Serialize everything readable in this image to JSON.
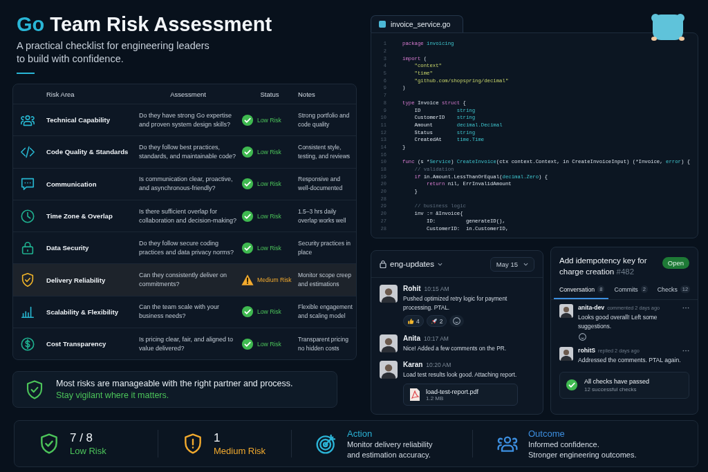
{
  "header": {
    "title_accent": "Go",
    "title": "Team Risk Assessment",
    "subtitle": "A practical checklist for engineering leaders to build with confidence."
  },
  "table": {
    "columns": [
      "Risk Area",
      "Assessment",
      "Status",
      "Notes"
    ],
    "rows": [
      {
        "area": "Technical Capability",
        "assessment": "Do they have strong Go expertise and proven system design skills?",
        "status": "Low Risk",
        "kind": "low",
        "notes": "Strong portfolio and code quality",
        "highlighted": false
      },
      {
        "area": "Code Quality & Standards",
        "assessment": "Do they follow best practices, standards, and maintainable code?",
        "status": "Low Risk",
        "kind": "low",
        "notes": "Consistent style, testing, and reviews",
        "highlighted": false
      },
      {
        "area": "Communication",
        "assessment": "Is communication clear, proactive, and asynchronous-friendly?",
        "status": "Low Risk",
        "kind": "low",
        "notes": "Responsive and well-documented",
        "highlighted": false
      },
      {
        "area": "Time Zone & Overlap",
        "assessment": "Is there sufficient overlap for collaboration and decision-making?",
        "status": "Low Risk",
        "kind": "low",
        "notes": "1.5–3 hrs daily overlap works well",
        "highlighted": false
      },
      {
        "area": "Data Security",
        "assessment": "Do they follow secure coding practices and data privacy norms?",
        "status": "Low Risk",
        "kind": "low",
        "notes": "Security practices in place",
        "highlighted": false
      },
      {
        "area": "Delivery Reliability",
        "assessment": "Can they consistently deliver on commitments?",
        "status": "Medium Risk",
        "kind": "medium",
        "notes": "Monitor scope creep and estimations",
        "highlighted": true
      },
      {
        "area": "Scalability & Flexibility",
        "assessment": "Can the team scale with your business needs?",
        "status": "Low Risk",
        "kind": "low",
        "notes": "Flexible engagement and scaling model",
        "highlighted": false
      },
      {
        "area": "Cost Transparency",
        "assessment": "Is pricing clear, fair, and aligned to value delivered?",
        "status": "Low Risk",
        "kind": "low",
        "notes": "Transparent pricing no hidden costs",
        "highlighted": false
      }
    ]
  },
  "summary": {
    "text": "Most risks are manageable with the right partner and process.",
    "note": "Stay vigilant where it matters."
  },
  "code_editor": {
    "tab": "invoice_service.go",
    "lines": [
      {
        "number": "1",
        "tokens": [
          {
            "text": "package",
            "kind": "keyword"
          },
          {
            "text": " invoicing",
            "kind": "type"
          }
        ]
      },
      {
        "number": "2"
      },
      {
        "number": "3",
        "tokens": [
          {
            "text": "import",
            "kind": "keyword"
          },
          {
            "text": " (",
            "kind": "plain"
          }
        ]
      },
      {
        "number": "4",
        "tokens": [
          {
            "text": "    \"context\"",
            "kind": "string"
          }
        ]
      },
      {
        "number": "5",
        "tokens": [
          {
            "text": "    \"time\"",
            "kind": "string"
          }
        ]
      },
      {
        "number": "6",
        "tokens": [
          {
            "text": "    \"github.com/shopspring/decimal\"",
            "kind": "string"
          }
        ]
      },
      {
        "number": "9",
        "tokens": [
          {
            "text": ")",
            "kind": "plain"
          }
        ]
      },
      {
        "number": "7"
      },
      {
        "number": "8",
        "tokens": [
          {
            "text": "type",
            "kind": "keyword"
          },
          {
            "text": " Invoice ",
            "kind": "plain"
          },
          {
            "text": "struct",
            "kind": "keyword"
          },
          {
            "text": " {",
            "kind": "plain"
          }
        ]
      },
      {
        "number": "9",
        "tokens": [
          {
            "text": "    ID            ",
            "kind": "plain"
          },
          {
            "text": "string",
            "kind": "type"
          }
        ]
      },
      {
        "number": "10",
        "tokens": [
          {
            "text": "    CustomerID    ",
            "kind": "plain"
          },
          {
            "text": "string",
            "kind": "type"
          }
        ]
      },
      {
        "number": "11",
        "tokens": [
          {
            "text": "    Amount        ",
            "kind": "plain"
          },
          {
            "text": "decimal.Decimal",
            "kind": "type"
          }
        ]
      },
      {
        "number": "12",
        "tokens": [
          {
            "text": "    Status        ",
            "kind": "plain"
          },
          {
            "text": "string",
            "kind": "type"
          }
        ]
      },
      {
        "number": "13",
        "tokens": [
          {
            "text": "    CreatedAt     ",
            "kind": "plain"
          },
          {
            "text": "time.Time",
            "kind": "type"
          }
        ]
      },
      {
        "number": "14",
        "tokens": [
          {
            "text": "}",
            "kind": "plain"
          }
        ]
      },
      {
        "number": "16"
      },
      {
        "number": "10",
        "tokens": [
          {
            "text": "func",
            "kind": "keyword"
          },
          {
            "text": " (s *",
            "kind": "plain"
          },
          {
            "text": "Service",
            "kind": "type"
          },
          {
            "text": ") ",
            "kind": "plain"
          },
          {
            "text": "CreateInvoice",
            "kind": "type"
          },
          {
            "text": "(ctx context.Context, in CreateInvoiceInput) (*Invoice, ",
            "kind": "plain"
          },
          {
            "text": "error",
            "kind": "type"
          },
          {
            "text": ") {",
            "kind": "plain"
          }
        ]
      },
      {
        "number": "18",
        "tokens": [
          {
            "text": "    // validation",
            "kind": "comment"
          }
        ]
      },
      {
        "number": "19",
        "tokens": [
          {
            "text": "    if",
            "kind": "keyword"
          },
          {
            "text": " in.Amount.LessThanOrEqual(",
            "kind": "plain"
          },
          {
            "text": "decimal.Zero",
            "kind": "type"
          },
          {
            "text": ") {",
            "kind": "plain"
          }
        ]
      },
      {
        "number": "20",
        "tokens": [
          {
            "text": "        return",
            "kind": "keyword"
          },
          {
            "text": " nil, ErrInvalidAmount",
            "kind": "plain"
          }
        ]
      },
      {
        "number": "20",
        "tokens": [
          {
            "text": "    }",
            "kind": "plain"
          }
        ]
      },
      {
        "number": "28"
      },
      {
        "number": "29",
        "tokens": [
          {
            "text": "    // business logic",
            "kind": "comment"
          }
        ]
      },
      {
        "number": "20",
        "tokens": [
          {
            "text": "    inv := &Invoice{",
            "kind": "plain"
          }
        ]
      },
      {
        "number": "27",
        "tokens": [
          {
            "text": "        ID:          generateID(),",
            "kind": "plain"
          }
        ]
      },
      {
        "number": "28",
        "tokens": [
          {
            "text": "        CustomerID:  in.CustomerID,",
            "kind": "plain"
          }
        ]
      }
    ]
  },
  "chat": {
    "channel": "eng-updates",
    "date": "May 15",
    "messages": [
      {
        "name": "Rohit",
        "time": "10:15 AM",
        "text": "Pushed optimized retry logic for payment processing. PTAL.",
        "reactions": [
          {
            "kind": "thumbs-up",
            "count": "4"
          },
          {
            "kind": "rocket",
            "count": "2"
          }
        ]
      },
      {
        "name": "Anita",
        "time": "10:17 AM",
        "text": "Nice! Added a few comments on the PR."
      },
      {
        "name": "Karan",
        "time": "10:20 AM",
        "text": "Load test results look good. Attaching report.",
        "attachment": {
          "name": "load-test-report.pdf",
          "size": "1.2 MB"
        }
      }
    ]
  },
  "pull_request": {
    "title": "Add idempotency key for charge creation",
    "number": "#482",
    "state": "Open",
    "tabs": [
      {
        "label": "Conversation",
        "count": "8",
        "selected": true
      },
      {
        "label": "Commits",
        "count": "2",
        "selected": false
      },
      {
        "label": "Checks",
        "count": "12",
        "selected": false
      }
    ],
    "comments": [
      {
        "author": "anita-dev",
        "action": "commented 2 days ago",
        "text": "Looks good overall! Left some suggestions.",
        "add_reaction": true
      },
      {
        "author": "rohitS",
        "action": "replied 2 days ago",
        "text": "Addressed the comments. PTAL again.",
        "add_reaction": false
      }
    ],
    "checks": {
      "title": "All checks have passed",
      "detail": "12 successful checks"
    }
  },
  "stats": [
    {
      "kind": "stat",
      "color": "#4cc45a",
      "value": "7 / 8",
      "label": "Low Risk"
    },
    {
      "kind": "stat",
      "color": "#f2aa2e",
      "value": "1",
      "label": "Medium Risk"
    },
    {
      "kind": "info",
      "color": "#2bb3d6",
      "title": "Action",
      "lines": [
        "Monitor delivery reliability",
        "and estimation accuracy."
      ]
    },
    {
      "kind": "info",
      "color": "#3d8fe0",
      "title": "Outcome",
      "lines": [
        "Informed confidence.",
        "Stronger engineering outcomes."
      ]
    }
  ]
}
